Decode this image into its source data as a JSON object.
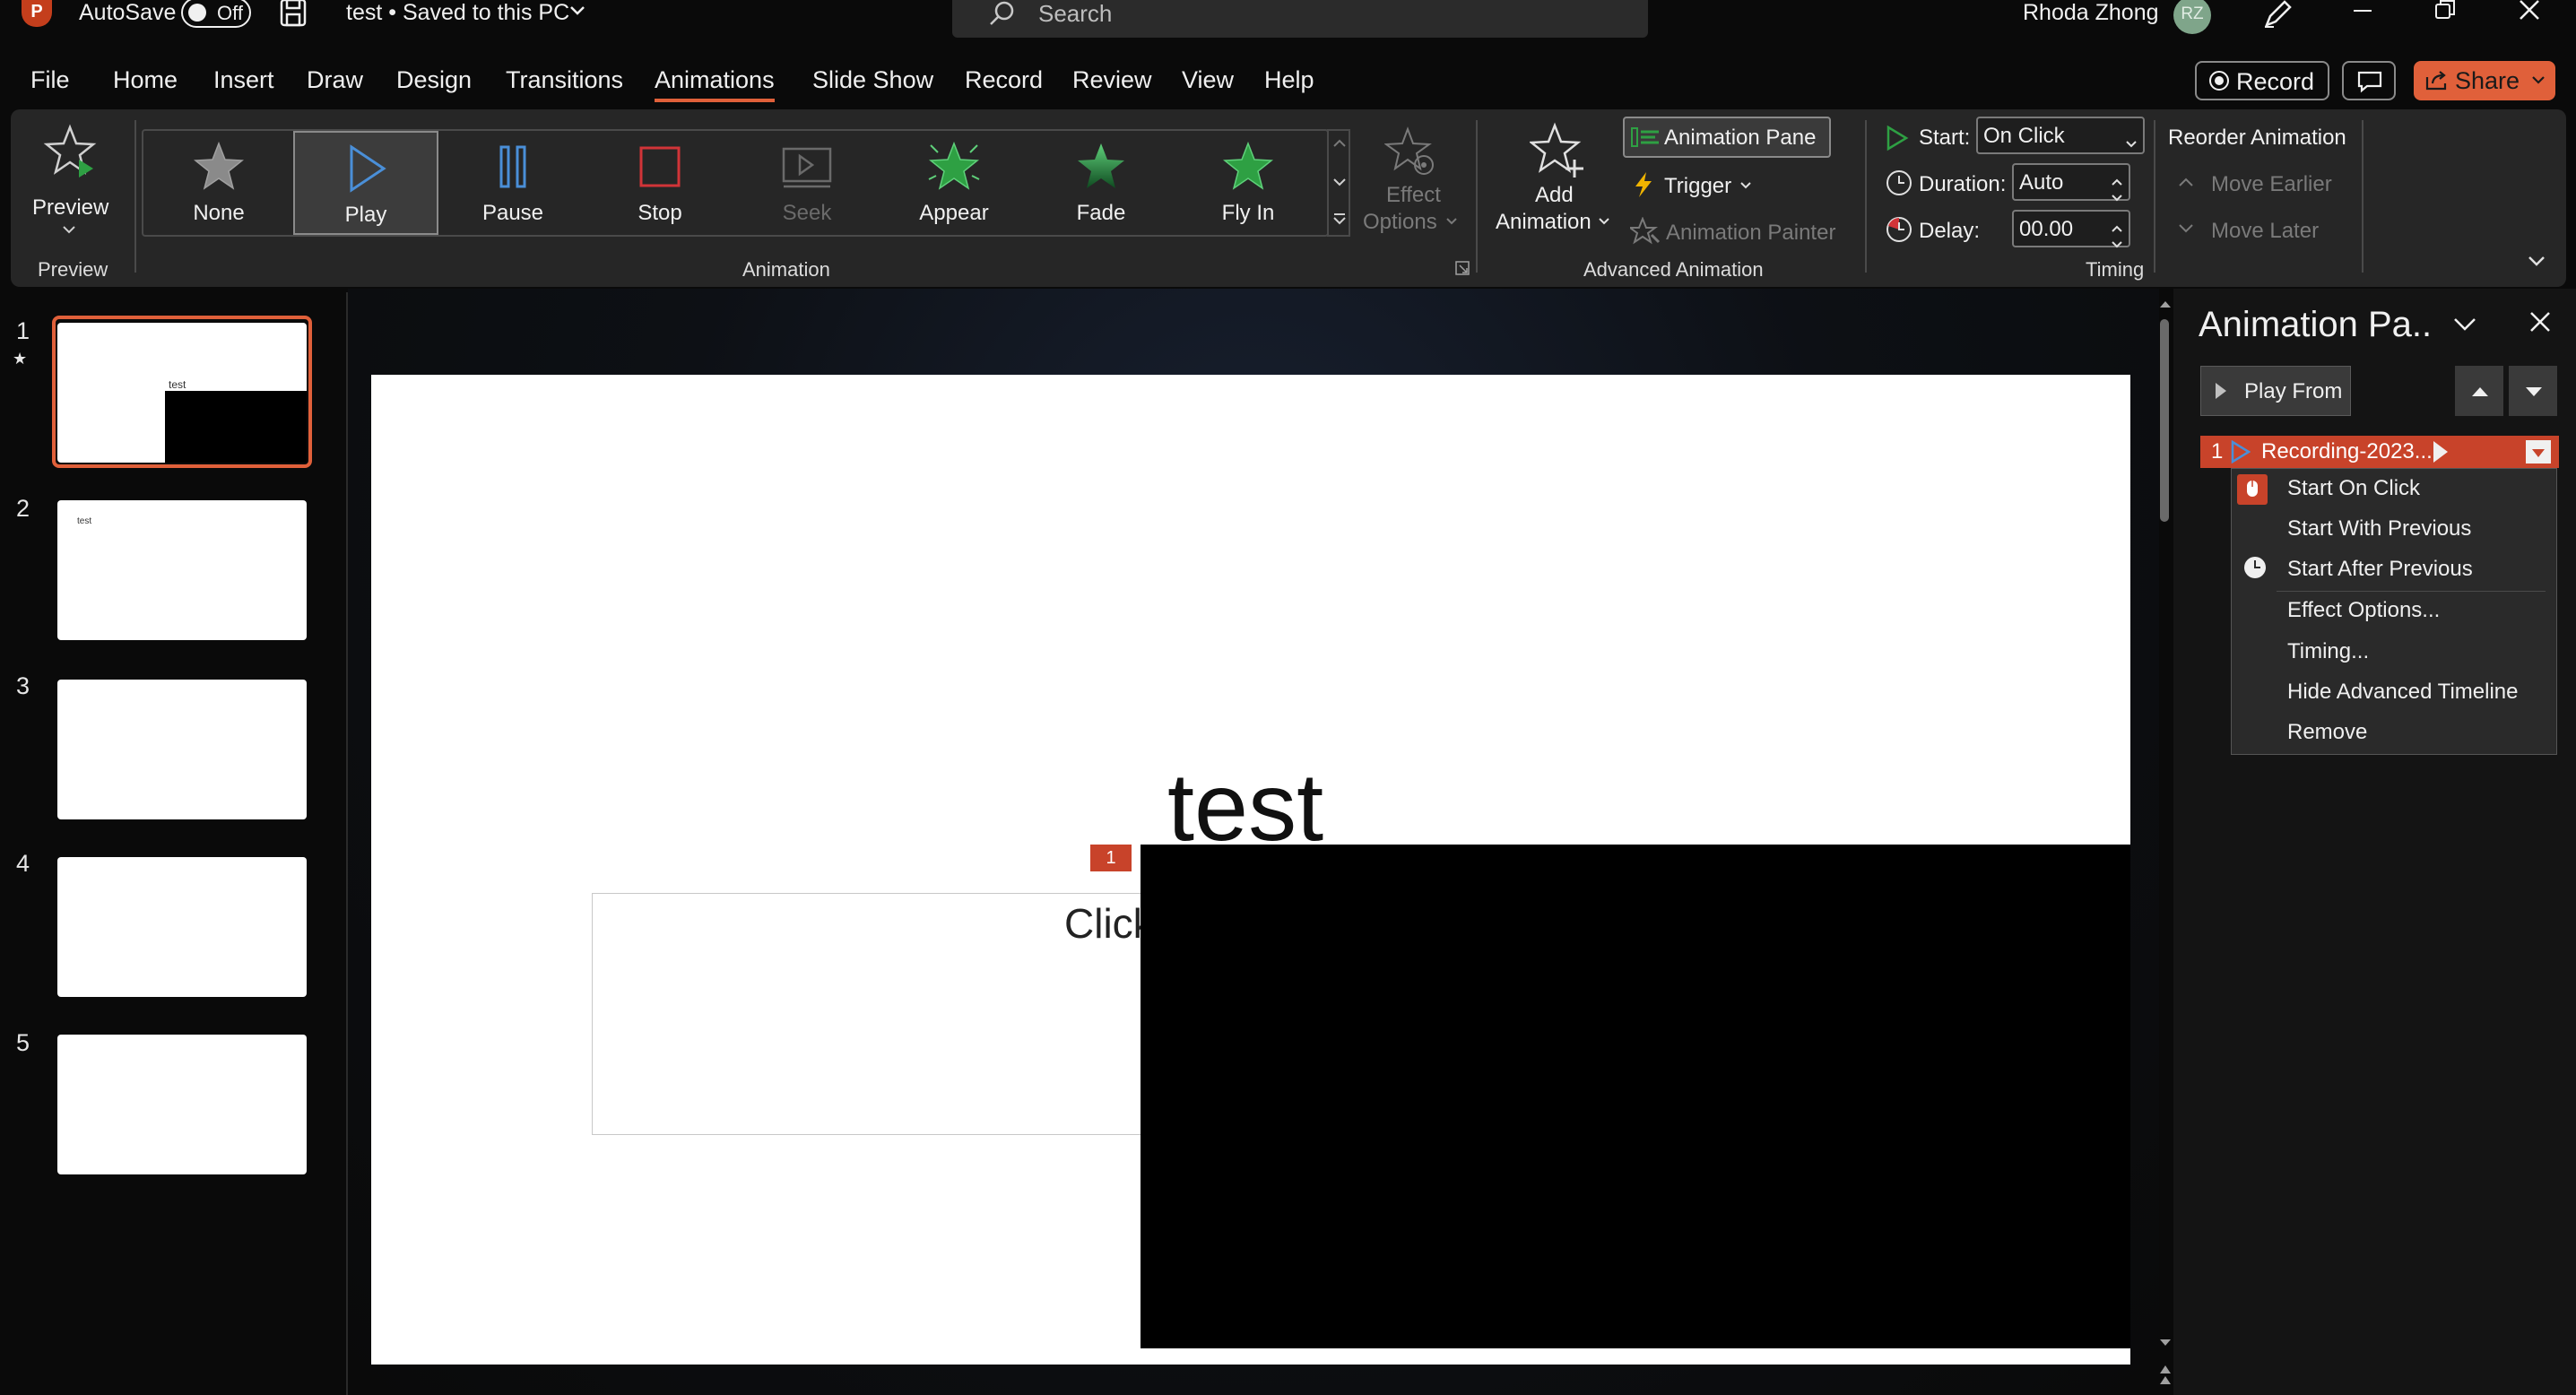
{
  "titlebar": {
    "autosave_label": "AutoSave",
    "autosave_state": "Off",
    "doc_title": "test • Saved to this PC",
    "search_placeholder": "Search",
    "user_name": "Rhoda Zhong",
    "user_initials": "RZ"
  },
  "menu": {
    "items": [
      "File",
      "Home",
      "Insert",
      "Draw",
      "Design",
      "Transitions",
      "Animations",
      "Slide Show",
      "Record",
      "Review",
      "View",
      "Help"
    ],
    "active": "Animations",
    "record_button": "Record",
    "share_button": "Share"
  },
  "ribbon": {
    "preview": {
      "label": "Preview",
      "group": "Preview"
    },
    "animation": {
      "group": "Animation",
      "items": [
        {
          "label": "None",
          "color": "#8a8a8a"
        },
        {
          "label": "Play",
          "color": "#4a8fd8"
        },
        {
          "label": "Pause",
          "color": "#4a8fd8"
        },
        {
          "label": "Stop",
          "color": "#d13438"
        },
        {
          "label": "Seek",
          "color": "#6a6a6a"
        },
        {
          "label": "Appear",
          "color": "#2ea043"
        },
        {
          "label": "Fade",
          "color": "#2ea043"
        },
        {
          "label": "Fly In",
          "color": "#2ea043"
        }
      ],
      "selected": "Play",
      "effect_options_line1": "Effect",
      "effect_options_line2": "Options"
    },
    "advanced": {
      "group": "Advanced Animation",
      "add_line1": "Add",
      "add_line2": "Animation",
      "animation_pane": "Animation Pane",
      "trigger": "Trigger",
      "animation_painter": "Animation Painter"
    },
    "timing": {
      "group": "Timing",
      "start_label": "Start:",
      "start_value": "On Click",
      "duration_label": "Duration:",
      "duration_value": "Auto",
      "delay_label": "Delay:",
      "delay_value": "00.00"
    },
    "reorder": {
      "title": "Reorder Animation",
      "earlier": "Move Earlier",
      "later": "Move Later"
    }
  },
  "slides": {
    "numbers": [
      "1",
      "2",
      "3",
      "4",
      "5"
    ],
    "thumb1_text": "test",
    "thumb2_text": "test"
  },
  "slide": {
    "title": "test",
    "body_placeholder": "Click",
    "anim_tag": "1"
  },
  "animation_pane": {
    "title": "Animation Pa..",
    "play_from": "Play From",
    "entry_number": "1",
    "entry_name": "Recording-2023...",
    "context_menu": [
      "Start On Click",
      "Start With Previous",
      "Start After Previous",
      "Effect Options...",
      "Timing...",
      "Hide Advanced Timeline",
      "Remove"
    ]
  },
  "colors": {
    "accent": "#e0603a",
    "entry_bg": "#c8432a",
    "share_bg": "#e0603a"
  }
}
